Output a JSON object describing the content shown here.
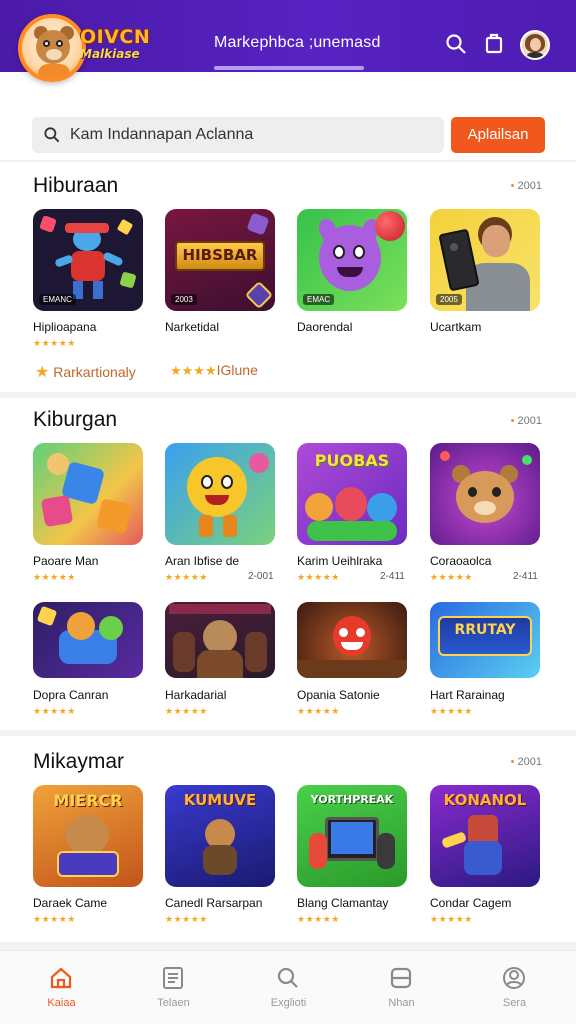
{
  "header": {
    "logo_line1": "OIVCN",
    "logo_line2": "Malkiase",
    "title": "Markephbca ;unemasd",
    "icons": [
      "search-icon",
      "bookmark-icon",
      "avatar"
    ]
  },
  "search": {
    "value": "Kam Indannapan Aclanna",
    "button_label": "Aplailsan"
  },
  "sections": [
    {
      "title": "Hiburaan",
      "count": "2001",
      "apps": [
        {
          "name": "Hiplioapana",
          "stars": "★★★★★",
          "tag": "EMANC"
        },
        {
          "name": "Narketidal",
          "stars": "",
          "tag": "2003",
          "banner": "HIBSBAR"
        },
        {
          "name": "Daorendal",
          "stars": "",
          "tag": "EMAC"
        },
        {
          "name": "Ucartkam",
          "stars": "",
          "tag": "2005"
        }
      ],
      "footer_left": "Rarkartionaly",
      "footer_right_stars": "★★★★",
      "footer_right": "IGlune"
    },
    {
      "title": "Kiburgan",
      "count": "2001",
      "apps": [
        {
          "name": "Paoare Man",
          "stars": "★★★★★",
          "meta": ""
        },
        {
          "name": "Aran Ibfise de",
          "stars": "★★★★★",
          "meta": "2-001"
        },
        {
          "name": "Karim Ueihlraka",
          "stars": "★★★★★",
          "meta": "2-411",
          "banner": "PUOBAS"
        },
        {
          "name": "Coraoaolca",
          "stars": "★★★★★",
          "meta": "2-411"
        },
        {
          "name": "Dopra Canran",
          "stars": "★★★★★",
          "meta": ""
        },
        {
          "name": "Harkadarial",
          "stars": "★★★★★",
          "meta": ""
        },
        {
          "name": "Opania Satonie",
          "stars": "★★★★★",
          "meta": ""
        },
        {
          "name": "Hart Rarainag",
          "stars": "★★★★★",
          "meta": "",
          "banner": "RRUTAY"
        }
      ]
    },
    {
      "title": "Mikaymar",
      "count": "2001",
      "apps": [
        {
          "name": "Daraek Came",
          "stars": "★★★★★",
          "banner": "MIERCR"
        },
        {
          "name": "Canedl Rarsarpan",
          "stars": "★★★★★",
          "banner": "KUMUVE"
        },
        {
          "name": "Blang Clamantay",
          "stars": "★★★★★",
          "banner": "YORTHPREAK"
        },
        {
          "name": "Condar Cagem",
          "stars": "★★★★★",
          "banner": "KONANOL"
        }
      ]
    }
  ],
  "bottom_nav": [
    {
      "label": "Kaiaa",
      "icon": "home-icon",
      "active": true
    },
    {
      "label": "Telaen",
      "icon": "list-icon",
      "active": false
    },
    {
      "label": "Exglioti",
      "icon": "search-icon",
      "active": false
    },
    {
      "label": "Nhan",
      "icon": "card-icon",
      "active": false
    },
    {
      "label": "Sera",
      "icon": "profile-icon",
      "active": false
    }
  ],
  "colors": {
    "header": "#5020b8",
    "accent": "#f0581e",
    "star": "#f5a623"
  }
}
